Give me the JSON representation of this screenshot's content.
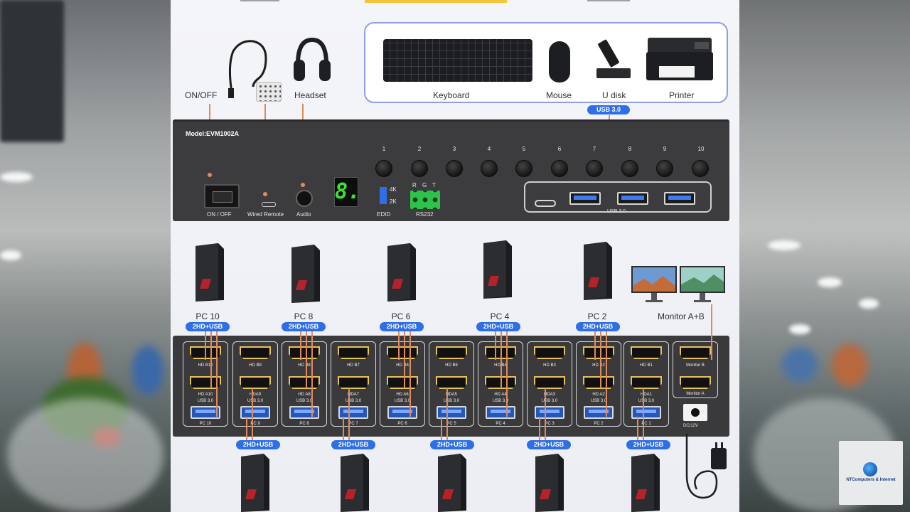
{
  "peripherals": {
    "on_off_label": "ON/OFF",
    "headset_label": "Headset",
    "keyboard_label": "Keyboard",
    "mouse_label": "Mouse",
    "udisk_label": "U disk",
    "printer_label": "Printer",
    "usb_badge": "USB 3.0"
  },
  "front_panel": {
    "model": "Model:EVM1002A",
    "on_off": "ON / OFF",
    "wired_remote": "Wired Remote",
    "audio": "Audio",
    "display_digit": "8.",
    "edid": "EDID",
    "edid_4k": "4K",
    "edid_2k": "2K",
    "rs232": "RS232",
    "rgt": [
      "R",
      "G",
      "T"
    ],
    "buttons": [
      "1",
      "2",
      "3",
      "4",
      "5",
      "6",
      "7",
      "8",
      "9",
      "10"
    ],
    "usb30": "USB 3.0"
  },
  "pcs_top": [
    {
      "label": "PC 10",
      "badge": "2HD+USB"
    },
    {
      "label": "PC 8",
      "badge": "2HD+USB"
    },
    {
      "label": "PC 6",
      "badge": "2HD+USB"
    },
    {
      "label": "PC 4",
      "badge": "2HD+USB"
    },
    {
      "label": "PC 2",
      "badge": "2HD+USB"
    }
  ],
  "monitor_label": "Monitor A+B",
  "back_panel": {
    "slots": [
      {
        "top": "HD B10",
        "bottom": "HD A10",
        "usb": "USB 3.0",
        "pc": "PC 10"
      },
      {
        "top": "HD B9",
        "bottom": "HDA9",
        "usb": "USB 3.0",
        "pc": "PC 9"
      },
      {
        "top": "HD B8",
        "bottom": "HD A8",
        "usb": "USB 3.0",
        "pc": "PC 8"
      },
      {
        "top": "HD B7",
        "bottom": "HDA7",
        "usb": "USB 3.0",
        "pc": "PC 7"
      },
      {
        "top": "HD B6",
        "bottom": "HD A6",
        "usb": "USB 3.0",
        "pc": "PC 6"
      },
      {
        "top": "HD B5",
        "bottom": "HDA5",
        "usb": "USB 3.0",
        "pc": "PC 5"
      },
      {
        "top": "HD B4",
        "bottom": "HD A4",
        "usb": "USB 3.0",
        "pc": "PC 4"
      },
      {
        "top": "HD B3",
        "bottom": "HDA3",
        "usb": "USB 3.0",
        "pc": "PC 3"
      },
      {
        "top": "HD B2",
        "bottom": "HD A2",
        "usb": "USB 3.0",
        "pc": "PC 2"
      },
      {
        "top": "HD B1",
        "bottom": "HDA1",
        "usb": "USB 3.0",
        "pc": "PC 1"
      }
    ],
    "monitor_b": "Monitor B",
    "monitor_a": "Monitor A",
    "dc": "DC/12V"
  },
  "pcs_bottom_badges": [
    "2HD+USB",
    "2HD+USB",
    "2HD+USB",
    "2HD+USB",
    "2HD+USB"
  ],
  "watermark": "NTComputers & Internet"
}
